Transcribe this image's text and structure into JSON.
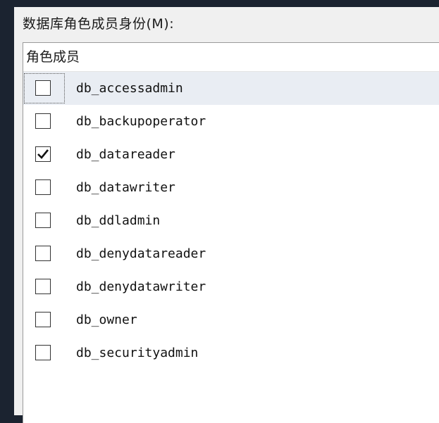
{
  "group_label": "数据库角色成员身份(M):",
  "list": {
    "column_header": "角色成员",
    "rows": [
      {
        "label": "db_accessadmin",
        "checked": false
      },
      {
        "label": "db_backupoperator",
        "checked": false
      },
      {
        "label": "db_datareader",
        "checked": true
      },
      {
        "label": "db_datawriter",
        "checked": false
      },
      {
        "label": "db_ddladmin",
        "checked": false
      },
      {
        "label": "db_denydatareader",
        "checked": false
      },
      {
        "label": "db_denydatawriter",
        "checked": false
      },
      {
        "label": "db_owner",
        "checked": false
      },
      {
        "label": "db_securityadmin",
        "checked": false
      }
    ]
  },
  "colors": {
    "window_bg": "#f0f0f0",
    "selected_row_bg": "#e9edf3",
    "border": "#9a9a9a"
  }
}
